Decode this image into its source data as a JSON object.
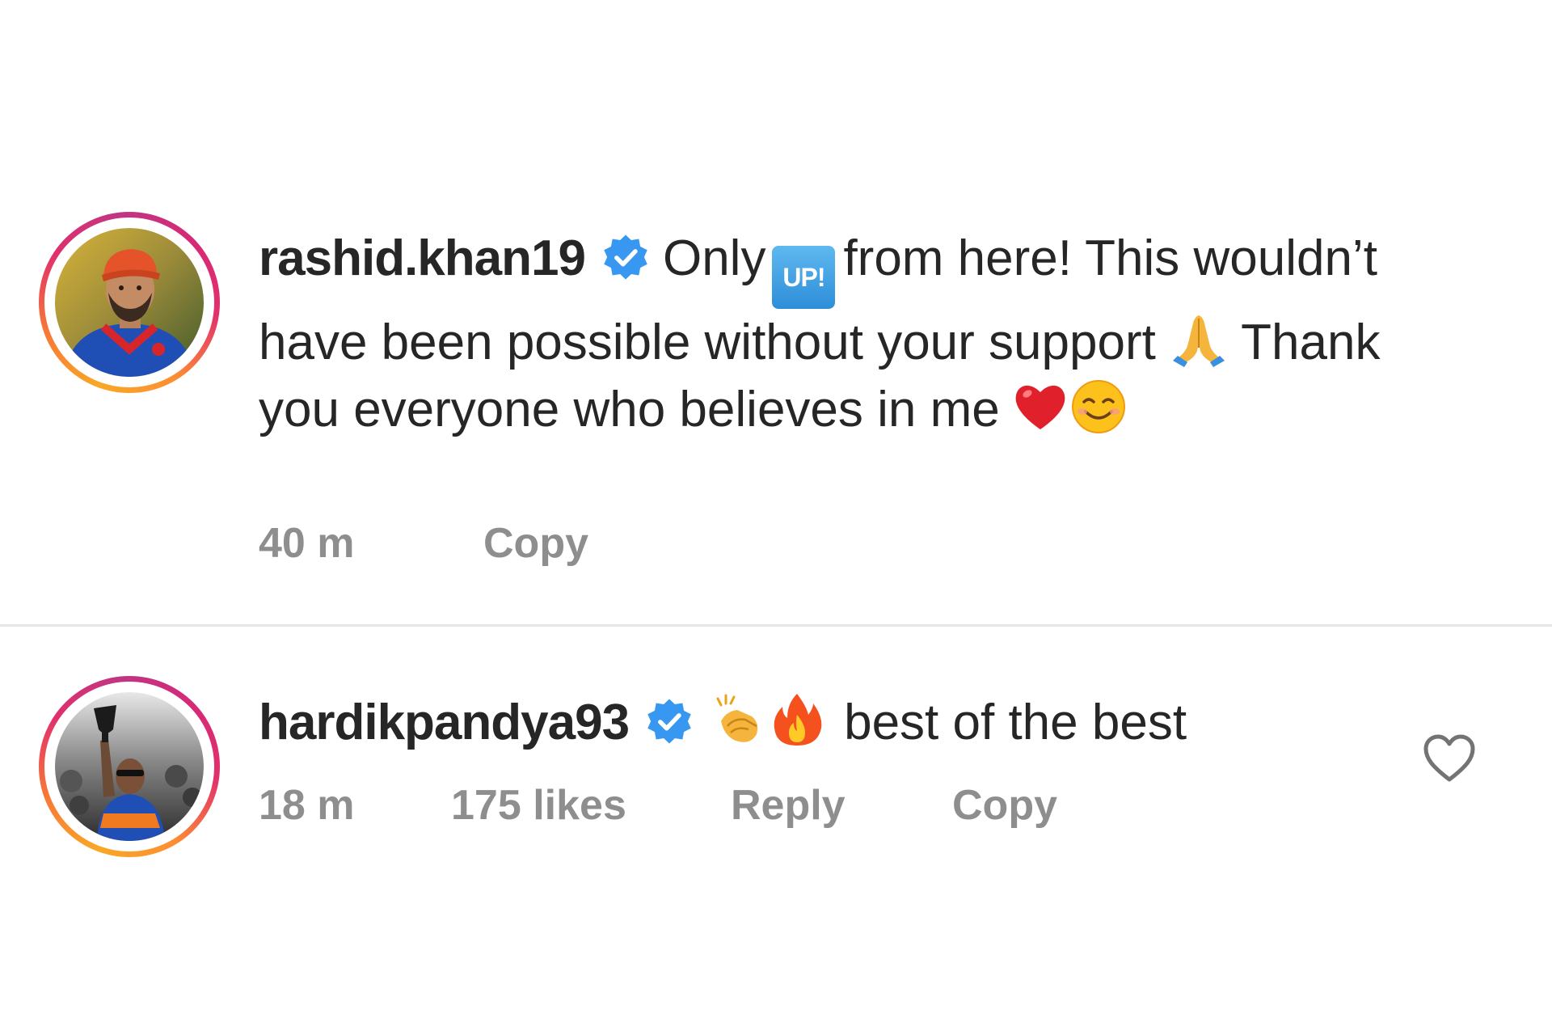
{
  "comments": [
    {
      "username": "rashid.khan19",
      "verified": true,
      "text_1": "Only",
      "emoji_up_label": "UP!",
      "text_2": "from here! This wouldn’t have been possible without your support",
      "emoji_pray": "folded-hands-emoji",
      "text_3": "Thank you everyone who believes in me",
      "emoji_heart": "red-heart-emoji",
      "emoji_smile": "smiling-face-emoji",
      "time": "40 m",
      "copy_label": "Copy"
    },
    {
      "username": "hardikpandya93",
      "verified": true,
      "emoji_clap": "clapping-hands-emoji",
      "emoji_fire": "fire-emoji",
      "text": "best of the best",
      "time": "18 m",
      "likes": "175 likes",
      "reply_label": "Reply",
      "copy_label": "Copy",
      "like_icon": "heart-outline-icon"
    }
  ],
  "colors": {
    "text": "#262626",
    "meta": "#8e8e8e",
    "verified_blue": "#3897f0",
    "divider": "#e6e6e6"
  }
}
